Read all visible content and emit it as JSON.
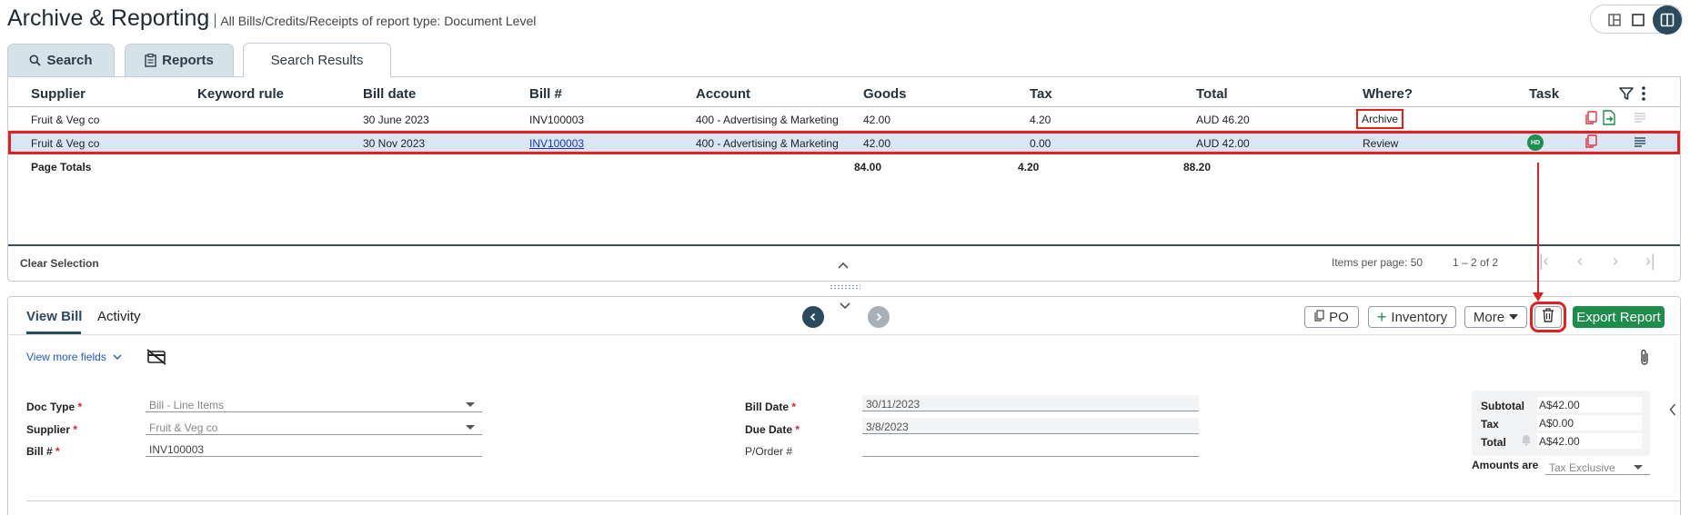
{
  "header": {
    "title": "Archive & Reporting",
    "subtitle": "All Bills/Credits/Receipts of report type: Document Level"
  },
  "tabs": [
    {
      "label": "Search",
      "icon": "search-icon"
    },
    {
      "label": "Reports",
      "icon": "report-icon"
    },
    {
      "label": "Search Results",
      "active": true
    }
  ],
  "table": {
    "columns": [
      "Supplier",
      "Keyword rule",
      "Bill date",
      "Bill #",
      "Account",
      "Goods",
      "Tax",
      "Total",
      "Where?",
      "Task"
    ],
    "rows": [
      {
        "supplier": "Fruit & Veg co",
        "keyword": "",
        "bill_date": "30 June 2023",
        "bill_no": "INV100003",
        "account": "400 - Advertising & Marketing",
        "goods": "42.00",
        "tax": "4.20",
        "total": "AUD 46.20",
        "where": "Archive",
        "task": ""
      },
      {
        "supplier": "Fruit & Veg co",
        "keyword": "",
        "bill_date": "30 Nov 2023",
        "bill_no": "INV100003",
        "account": "400 - Advertising & Marketing",
        "goods": "42.00",
        "tax": "0.00",
        "total": "AUD 42.00",
        "where": "Review",
        "task": "HD"
      }
    ],
    "totals": {
      "label": "Page Totals",
      "goods": "84.00",
      "tax": "4.20",
      "total": "88.20"
    }
  },
  "footer": {
    "clear_selection": "Clear Selection",
    "items_per_page_label": "Items per page:",
    "items_per_page": "50",
    "range": "1 – 2 of 2"
  },
  "detail": {
    "tabs": [
      "View Bill",
      "Activity"
    ],
    "buttons": {
      "po": "PO",
      "inventory": "Inventory",
      "more": "More",
      "export": "Export Report"
    },
    "view_more": "View more fields",
    "fields": {
      "doc_type_label": "Doc Type",
      "doc_type": "Bill - Line Items",
      "supplier_label": "Supplier",
      "supplier": "Fruit & Veg co",
      "bill_no_label": "Bill #",
      "bill_no": "INV100003",
      "bill_date_label": "Bill Date",
      "bill_date": "30/11/2023",
      "due_date_label": "Due Date",
      "due_date": "3/8/2023",
      "po_label": "P/Order #",
      "po": ""
    },
    "totals": {
      "subtotal_label": "Subtotal",
      "subtotal": "A$42.00",
      "tax_label": "Tax",
      "tax": "A$0.00",
      "total_label": "Total",
      "total": "A$42.00"
    },
    "amounts_label": "Amounts are",
    "amounts_value": "Tax Exclusive"
  },
  "colors": {
    "accent": "#2b4a5e",
    "export": "#1e8c4a",
    "highlight": "#e32020",
    "selected_row": "#dbe6f5"
  }
}
